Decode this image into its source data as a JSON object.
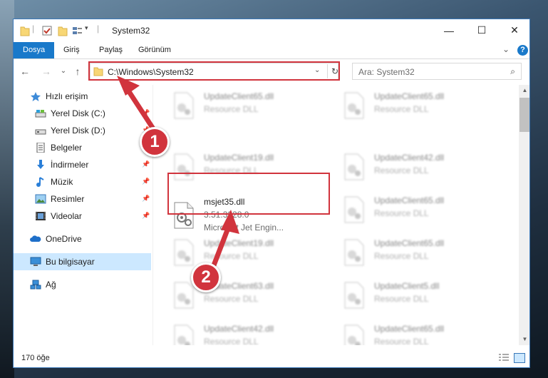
{
  "window": {
    "title": "System32",
    "controls": {
      "minimize": "—",
      "maximize": "☐",
      "close": "✕"
    }
  },
  "ribbon": {
    "tabs": [
      "Dosya",
      "Giriş",
      "Paylaş",
      "Görünüm"
    ],
    "help_icon": "?",
    "collapse_icon": "⌄"
  },
  "nav": {
    "back_icon": "←",
    "forward_icon": "→",
    "recent_icon": "⌄",
    "up_icon": "↑",
    "address": "C:\\Windows\\System32",
    "refresh_icon": "↻",
    "dropdown_icon": "⌄",
    "search_placeholder": "Ara: System32",
    "search_icon": "⌕"
  },
  "sidebar": {
    "items": [
      {
        "label": "Hızlı erişim",
        "icon": "star-icon",
        "pinned": false
      },
      {
        "label": "Yerel Disk (C:)",
        "icon": "drive-icon",
        "pinned": true
      },
      {
        "label": "Yerel Disk (D:)",
        "icon": "drive-icon",
        "pinned": true
      },
      {
        "label": "Belgeler",
        "icon": "document-icon",
        "pinned": true
      },
      {
        "label": "İndirmeler",
        "icon": "download-icon",
        "pinned": true
      },
      {
        "label": "Müzik",
        "icon": "music-icon",
        "pinned": true
      },
      {
        "label": "Resimler",
        "icon": "pictures-icon",
        "pinned": true
      },
      {
        "label": "Videolar",
        "icon": "videos-icon",
        "pinned": true
      },
      {
        "label": "OneDrive",
        "icon": "onedrive-icon",
        "pinned": false
      },
      {
        "label": "Bu bilgisayar",
        "icon": "computer-icon",
        "pinned": false,
        "selected": true
      },
      {
        "label": "Ağ",
        "icon": "network-icon",
        "pinned": false
      }
    ],
    "pin_glyph": "📌"
  },
  "files": {
    "left_column": [
      {
        "name": "UpdateClient65.dll",
        "type": "Resource DLL"
      },
      {
        "name": "UpdateClient19.dll",
        "type": "Resource DLL"
      },
      {
        "name": "msjet35.dll",
        "version": "3.51.3328.0",
        "description": "Microsoft Jet Engin...",
        "highlighted": true
      },
      {
        "name": "UpdateClient19.dll",
        "type": "Resource DLL"
      },
      {
        "name": "UpdateClient63.dll",
        "type": "Resource DLL"
      },
      {
        "name": "UpdateClient42.dll",
        "type": "Resource DLL"
      }
    ],
    "right_column": [
      {
        "name": "UpdateClient65.dll",
        "type": "Resource DLL"
      },
      {
        "name": "UpdateClient42.dll",
        "type": "Resource DLL"
      },
      {
        "name": "UpdateClient65.dll",
        "type": "Resource DLL"
      },
      {
        "name": "UpdateClient65.dll",
        "type": "Resource DLL"
      },
      {
        "name": "UpdateClient5.dll",
        "type": "Resource DLL"
      },
      {
        "name": "UpdateClient65.dll",
        "type": "Resource DLL"
      }
    ]
  },
  "status": {
    "item_count": "170 öğe"
  },
  "annotations": {
    "step1": "1",
    "step2": "2",
    "color": "#d1343d"
  },
  "colors": {
    "accent": "#1979ca",
    "selection": "#cce8ff",
    "highlight": "#d1343d"
  }
}
